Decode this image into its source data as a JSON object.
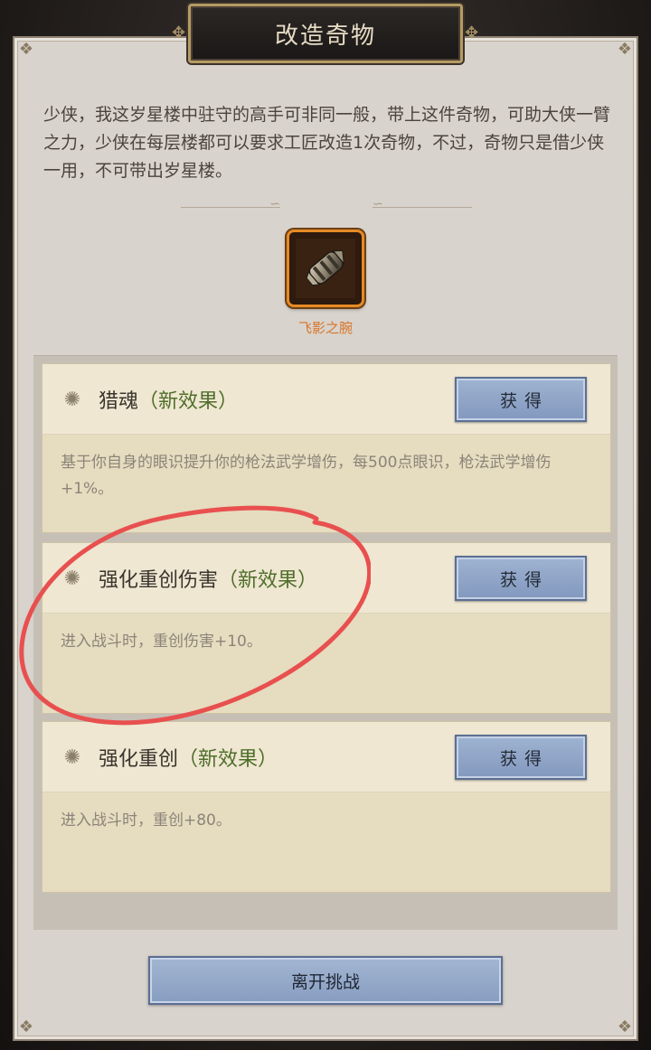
{
  "title": "改造奇物",
  "intro": "少侠，我这岁星楼中驻守的高手可非同一般，带上这件奇物，可助大侠一臂之力，少侠在每层楼都可以要求工匠改造1次奇物，不过，奇物只是借少侠一用，不可带出岁星楼。",
  "item": {
    "name": "飞影之腕",
    "icon": "bracer-icon",
    "rarity_color": "#e68a25"
  },
  "effects": [
    {
      "name": "猎魂",
      "tag": "（新效果）",
      "description": "基于你自身的眼识提升你的枪法武学增伤，每500点眼识，枪法武学增伤+1%。",
      "button": "获得"
    },
    {
      "name": "强化重创伤害",
      "tag": "（新效果）",
      "description": "进入战斗时，重创伤害+10。",
      "button": "获得"
    },
    {
      "name": "强化重创",
      "tag": "（新效果）",
      "description": "进入战斗时，重创+80。",
      "button": "获得"
    }
  ],
  "leave_button": "离开挑战",
  "colors": {
    "accent_green": "#4f6e2a",
    "button_blue": "#8298be",
    "annotation_red": "#e8504f"
  }
}
